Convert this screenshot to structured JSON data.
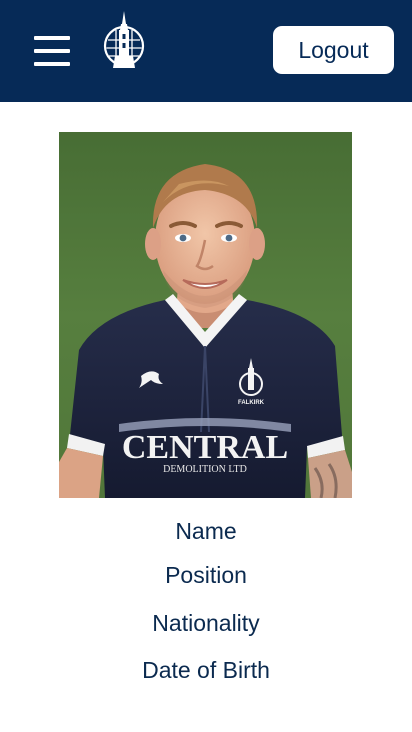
{
  "header": {
    "background": "#062a57",
    "menu_icon": "hamburger-menu-icon",
    "logo_icon": "club-crest-icon",
    "logout_label": "Logout"
  },
  "player": {
    "photo_icon": "player-photo",
    "shirt": {
      "sponsor_line1": "CENTRAL",
      "sponsor_line2": "DEMOLITION LTD",
      "crest_text": "FALKIRK",
      "color": "#1c2440"
    },
    "fields": {
      "name": "Name",
      "position": "Position",
      "nationality": "Nationality",
      "date_of_birth": "Date of Birth"
    }
  },
  "colors": {
    "brand_navy": "#062a57",
    "text_navy": "#0b2a4f",
    "pitch_green": "#4f7a3a"
  }
}
